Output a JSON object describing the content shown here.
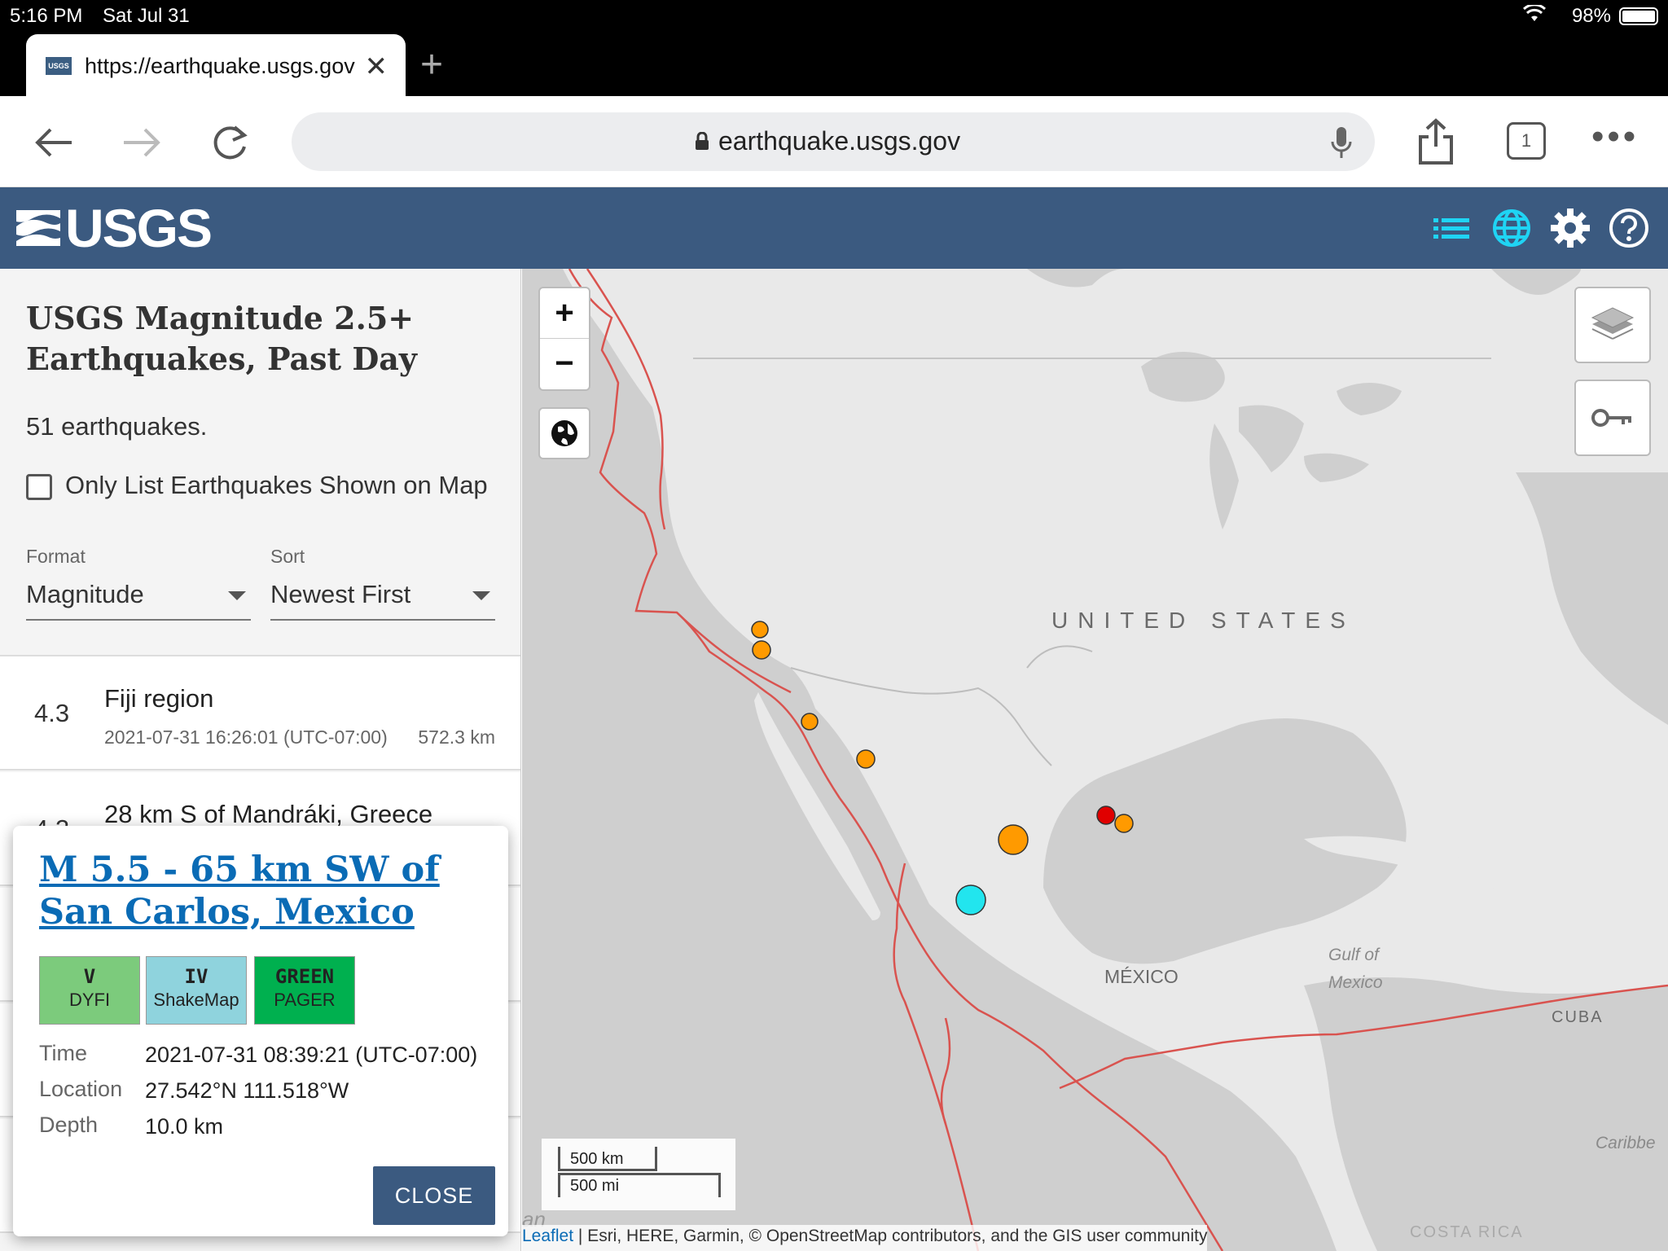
{
  "status_bar": {
    "time": "5:16 PM",
    "date": "Sat Jul 31",
    "battery": "98%"
  },
  "browser": {
    "tab_title": "https://earthquake.usgs.gov",
    "url_host": "earthquake.usgs.gov",
    "tab_count": "1"
  },
  "header": {
    "logo_text": "USGS"
  },
  "sidebar": {
    "title": "USGS Magnitude 2.5+ Earthquakes, Past Day",
    "count": "51 earthquakes.",
    "only_list_label": "Only List Earthquakes Shown on Map",
    "format_label": "Format",
    "format_value": "Magnitude",
    "sort_label": "Sort",
    "sort_value": "Newest First",
    "rows": [
      {
        "mag": "4.3",
        "place": "Fiji region",
        "time": "2021-07-31 16:26:01 (UTC-07:00)",
        "depth": "572.3 km"
      },
      {
        "mag": "4.2",
        "place": "28 km S of Mandráki, Greece",
        "time": "",
        "depth": ""
      }
    ]
  },
  "popup": {
    "title": "M 5.5 - 65 km SW of San Carlos, Mexico",
    "badges": [
      {
        "level": "V",
        "label": "DYFI",
        "color": "#7ccb7c"
      },
      {
        "level": "IV",
        "label": "ShakeMap",
        "color": "#8fd3dd"
      },
      {
        "level": "GREEN",
        "label": "PAGER",
        "color": "#00b04f"
      }
    ],
    "time_label": "Time",
    "time_value": "2021-07-31 08:39:21 (UTC-07:00)",
    "location_label": "Location",
    "location_value": "27.542°N 111.518°W",
    "depth_label": "Depth",
    "depth_value": "10.0 km",
    "close_label": "CLOSE"
  },
  "map": {
    "zoom_in": "+",
    "zoom_out": "−",
    "labels": {
      "united_states": "UNITED STATES",
      "mexico": "MÉXICO",
      "gulf": "Gulf of Mexico",
      "cuba": "CUBA",
      "caribbean": "Caribbe",
      "costa_rica": "COSTA RICA",
      "ocean_fragment": "an"
    },
    "scale_km": "500 km",
    "scale_mi": "500 mi",
    "attribution_link": "Leaflet",
    "attribution_text": " | Esri, HERE, Garmin, © OpenStreetMap contributors, and the GIS user community",
    "marker_colors": {
      "orange": "#ff9a00",
      "red": "#e00000",
      "cyan": "#22e5ee"
    }
  }
}
